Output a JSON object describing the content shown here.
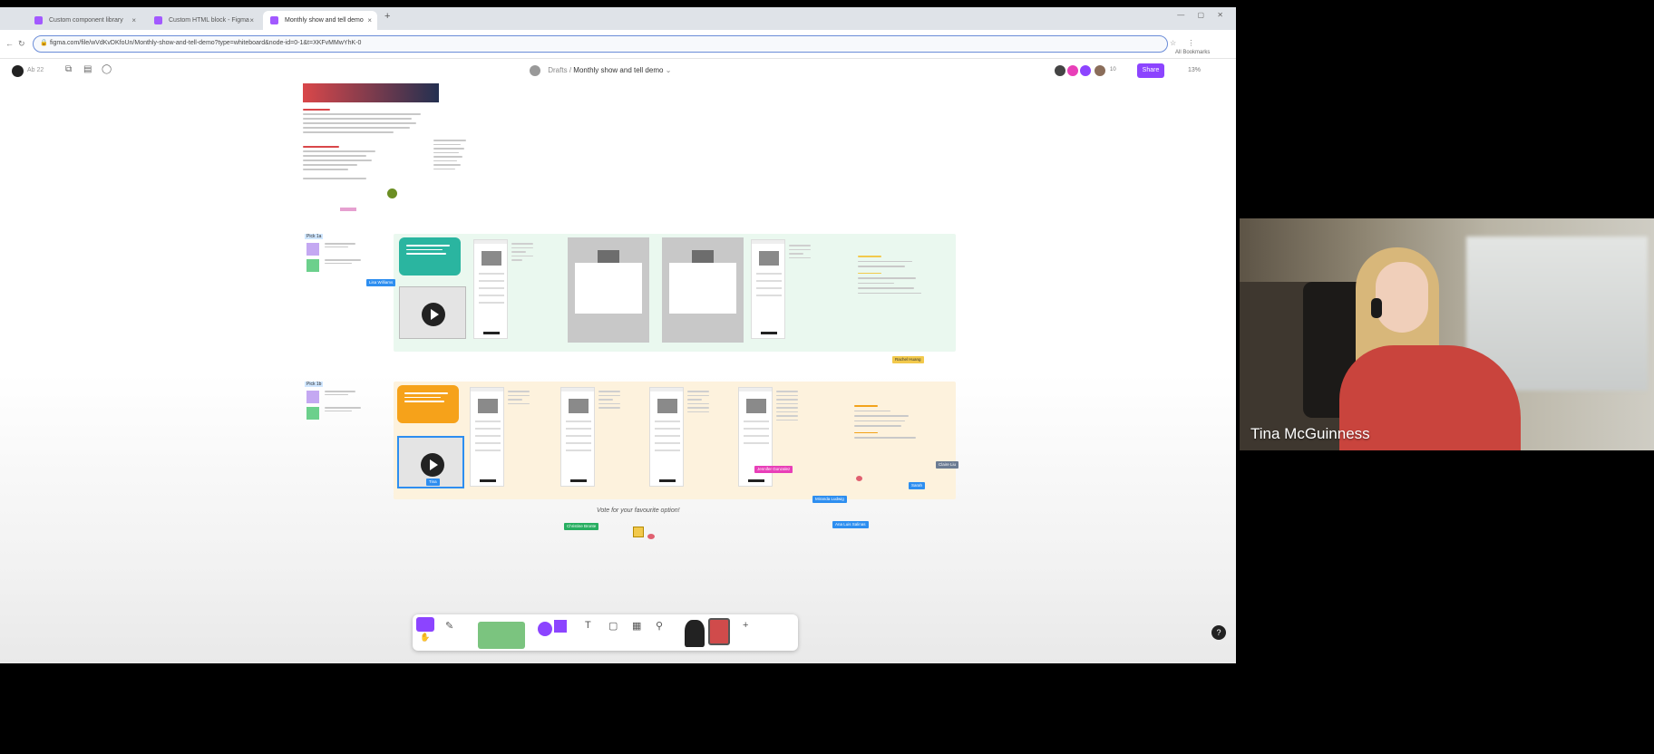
{
  "browser": {
    "tabs": [
      {
        "label": "Custom component library"
      },
      {
        "label": "Custom HTML block - Figma"
      },
      {
        "label": "Monthly show and tell demo"
      }
    ],
    "new_tab_glyph": "+",
    "url": "figma.com/file/wVdKvDKfoUn/Monthly-show-and-tell-demo?type=whiteboard&node-id=0-1&t=XKFvMMwYhK-0",
    "bookmarks_label": "All Bookmarks"
  },
  "figma": {
    "zoom_left": "Ab 22",
    "breadcrumb_root": "Drafts",
    "breadcrumb_separator": "/",
    "file_title": "Monthly show and tell demo",
    "share_label": "Share",
    "zoom_level": "13%",
    "avatar_count": "10"
  },
  "canvas": {
    "pick_labels": [
      "Pick 1a",
      "Pick 1b"
    ],
    "vote_text": "Vote for your favourite option!",
    "cursors": [
      {
        "name": "Lisa Williams",
        "color": "#2d8ef0"
      },
      {
        "name": "Rachel Huang",
        "color": "#f2c94c"
      },
      {
        "name": "Jennifer Gonzalez",
        "color": "#e83fb8"
      },
      {
        "name": "Claire Liu",
        "color": "#6b7c93"
      },
      {
        "name": "Sarah",
        "color": "#2d8ef0"
      },
      {
        "name": "Miranda Ludwig",
        "color": "#2d8ef0"
      },
      {
        "name": "Ana Luis Salinas",
        "color": "#2d8ef0"
      },
      {
        "name": "Christine Bronte",
        "color": "#27ae60"
      },
      {
        "name": "Tina",
        "color": "#2d8ef0"
      }
    ]
  },
  "toolbar": {
    "text_tool": "T",
    "add_more": "+"
  },
  "help_glyph": "?",
  "webcam": {
    "participant_name": "Tina McGuinness"
  },
  "colors": {
    "figma_purple": "#8c44ff",
    "green_section": "#eaf8ef",
    "orange_section": "#fdf2dd",
    "teal_sticky": "#2ab5a0",
    "orange_sticky": "#f6a21a"
  }
}
